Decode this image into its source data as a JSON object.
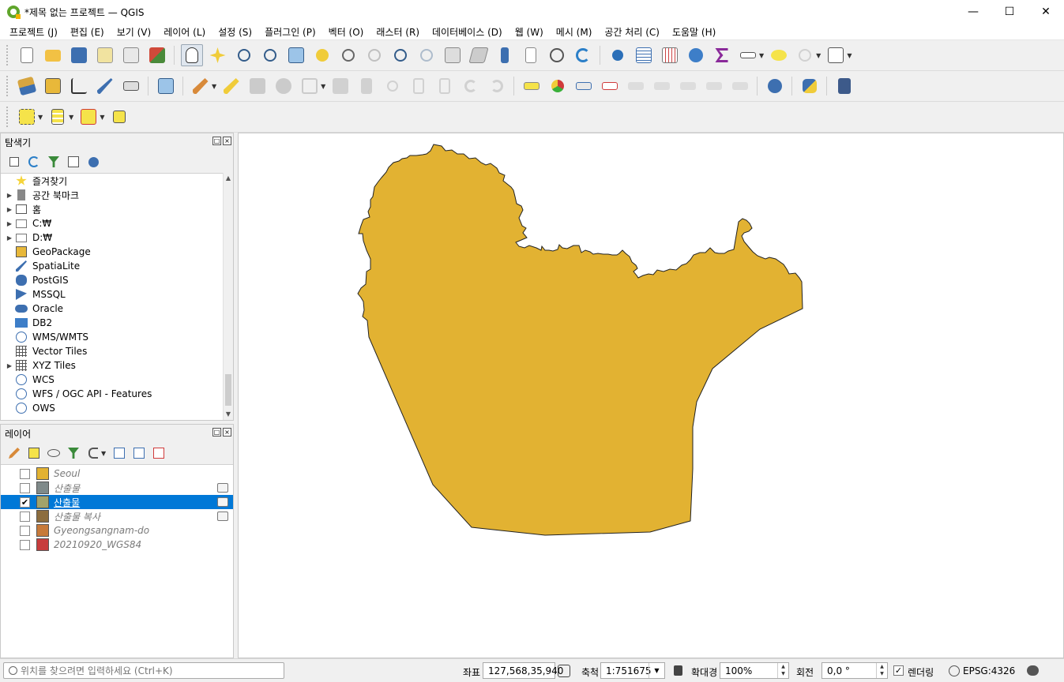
{
  "window": {
    "title": "*제목 없는 프로젝트 — QGIS"
  },
  "menu": [
    "프로젝트 (J)",
    "편집 (E)",
    "보기 (V)",
    "레이어 (L)",
    "설정 (S)",
    "플러그인 (P)",
    "벡터 (O)",
    "래스터 (R)",
    "데이터베이스 (D)",
    "웹 (W)",
    "메시 (M)",
    "공간 처리 (C)",
    "도움말 (H)"
  ],
  "browser": {
    "title": "탐색기",
    "items": [
      {
        "label": "즐겨찾기",
        "icon": "star-icon",
        "expandable": false
      },
      {
        "label": "공간 북마크",
        "icon": "bookmark-icon",
        "expandable": true
      },
      {
        "label": "홈",
        "icon": "home-folder-icon",
        "expandable": true
      },
      {
        "label": "C:₩",
        "icon": "drive-icon",
        "expandable": true
      },
      {
        "label": "D:₩",
        "icon": "drive-icon",
        "expandable": true
      },
      {
        "label": "GeoPackage",
        "icon": "geopackage-icon",
        "expandable": false
      },
      {
        "label": "SpatiaLite",
        "icon": "spatialite-icon",
        "expandable": false
      },
      {
        "label": "PostGIS",
        "icon": "postgis-icon",
        "expandable": false
      },
      {
        "label": "MSSQL",
        "icon": "mssql-icon",
        "expandable": false
      },
      {
        "label": "Oracle",
        "icon": "oracle-icon",
        "expandable": false
      },
      {
        "label": "DB2",
        "icon": "db2-icon",
        "expandable": false
      },
      {
        "label": "WMS/WMTS",
        "icon": "globe-icon",
        "expandable": false
      },
      {
        "label": "Vector Tiles",
        "icon": "grid-icon",
        "expandable": false
      },
      {
        "label": "XYZ Tiles",
        "icon": "grid-icon",
        "expandable": true
      },
      {
        "label": "WCS",
        "icon": "globe-icon",
        "expandable": false
      },
      {
        "label": "WFS / OGC API - Features",
        "icon": "globe-icon",
        "expandable": false
      },
      {
        "label": "OWS",
        "icon": "globe-icon",
        "expandable": false
      }
    ]
  },
  "layers": {
    "title": "레이어",
    "items": [
      {
        "name": "Seoul",
        "color": "#e2b232",
        "checked": false,
        "selected": false,
        "side_icon": false
      },
      {
        "name": "산출물",
        "color": "#7f8a8a",
        "checked": false,
        "selected": false,
        "side_icon": true
      },
      {
        "name": "산출물",
        "color": "#a3a36b",
        "checked": true,
        "selected": true,
        "side_icon": true
      },
      {
        "name": "산출물 복사",
        "color": "#8c6d3e",
        "checked": false,
        "selected": false,
        "side_icon": true
      },
      {
        "name": "Gyeongsangnam-do",
        "color": "#c77a3a",
        "checked": false,
        "selected": false,
        "side_icon": false
      },
      {
        "name": "20210920_WGS84",
        "color": "#c73c3c",
        "checked": false,
        "selected": false,
        "side_icon": false
      }
    ]
  },
  "map": {
    "polygon_fill": "#e2b232",
    "polygon_stroke": "#222222"
  },
  "status": {
    "search_placeholder": "위치를 찾으려면 입력하세요 (Ctrl+K)",
    "coord_label": "좌표",
    "coord_value": "127,568,35,940",
    "scale_label": "축척",
    "scale_value": "1:751675",
    "magnifier_label": "확대경",
    "magnifier_value": "100%",
    "rotation_label": "회전",
    "rotation_value": "0,0 °",
    "render_label": "렌더링",
    "crs_value": "EPSG:4326"
  }
}
